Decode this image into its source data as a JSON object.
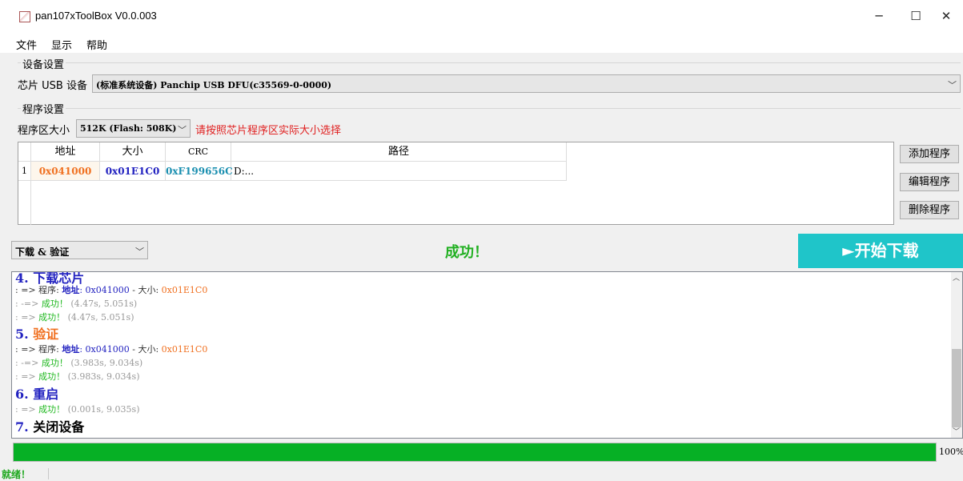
{
  "window": {
    "title": "pan107xToolBox V0.0.003",
    "minimize": "─",
    "maximize": "☐",
    "close": "✕"
  },
  "menu": [
    "文件",
    "显示",
    "帮助"
  ],
  "device_settings": {
    "group_label": "设备设置",
    "usb_label": "芯片 USB 设备",
    "usb_value": "(标准系统设备) Panchip USB DFU(c35569-0-0000)"
  },
  "program_settings": {
    "group_label": "程序设置",
    "area_label": "程序区大小",
    "area_value": "512K (Flash: 508K)",
    "hint": "请按照芯片程序区实际大小选择",
    "table": {
      "headers": [
        "地址",
        "大小",
        "CRC",
        "路径"
      ],
      "rows": [
        {
          "index": "1",
          "address": "0x041000",
          "size": "0x01E1C0",
          "crc": "0xF199656C",
          "path": "D:..."
        }
      ]
    },
    "buttons": [
      "添加程序",
      "编辑程序",
      "删除程序"
    ]
  },
  "action": {
    "mode_value": "下载 & 验证",
    "status": "成功！",
    "start_label": "►开始下载"
  },
  "log": {
    "lines": [
      {
        "type": "head",
        "text": "4. 下载芯片"
      },
      {
        "type": "prog",
        "prefix": ": => 程序: ",
        "addr_label": "地址",
        "addr": ": 0x041000",
        "sep": " - 大小: ",
        "size": "0x01E1C0"
      },
      {
        "type": "ok",
        "prefix": ": -=> ",
        "ok": "成功！",
        "time": " (4.47s, 5.051s)"
      },
      {
        "type": "ok",
        "prefix": ": => ",
        "ok": "成功！",
        "time": " (4.47s, 5.051s)"
      },
      {
        "type": "head",
        "num": "5. ",
        "text": "验证"
      },
      {
        "type": "prog",
        "prefix": ": => 程序: ",
        "addr_label": "地址",
        "addr": ": 0x041000",
        "sep": " - 大小: ",
        "size": "0x01E1C0"
      },
      {
        "type": "ok",
        "prefix": ": -=> ",
        "ok": "成功！",
        "time": " (3.983s, 9.034s)"
      },
      {
        "type": "ok",
        "prefix": ": => ",
        "ok": "成功！",
        "time": " (3.983s, 9.034s)"
      },
      {
        "type": "head",
        "text": "6. 重启"
      },
      {
        "type": "ok",
        "prefix": ": => ",
        "ok": "成功！",
        "time": " (0.001s, 9.035s)"
      },
      {
        "type": "head",
        "num": "7. ",
        "text": "关闭设备"
      }
    ]
  },
  "progress": {
    "value": 100,
    "label": "100%"
  },
  "statusbar": {
    "text": "就绪！"
  },
  "colors": {
    "start_button": "#1fc5c9",
    "success_green": "#22b022",
    "progress_green": "#06b025",
    "address_orange": "#f07020",
    "size_blue": "#2222c0",
    "crc_teal": "#1a8fb0",
    "hint_red": "#e02020"
  }
}
